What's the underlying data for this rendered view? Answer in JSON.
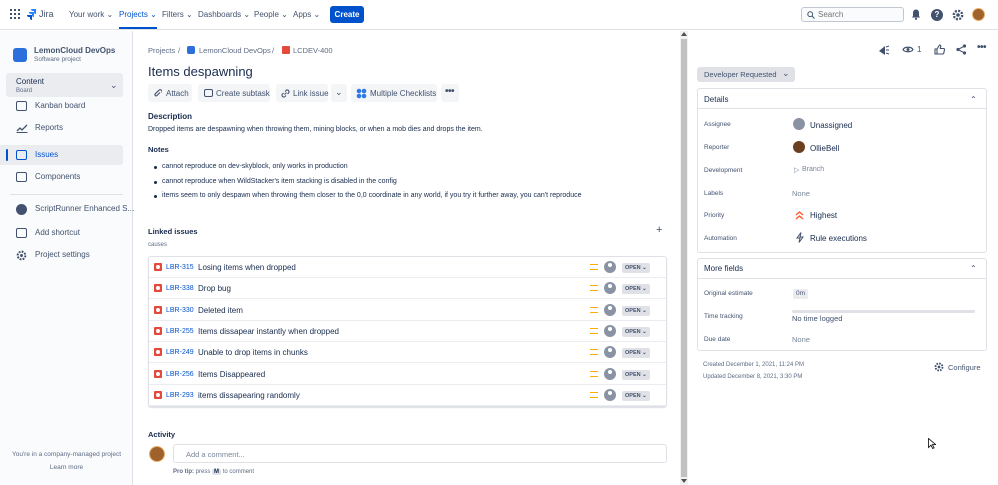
{
  "topnav": {
    "logo": "Jira",
    "items": [
      "Your work",
      "Projects",
      "Filters",
      "Dashboards",
      "People",
      "Apps"
    ],
    "create": "Create",
    "search_placeholder": "Search"
  },
  "sidebar": {
    "project_name": "LemonCloud DevOps",
    "project_type": "Software project",
    "section": "Content",
    "section_sub": "Board",
    "items": [
      "Kanban board",
      "Reports",
      "Issues",
      "Components",
      "ScriptRunner Enhanced S...",
      "Add shortcut",
      "Project settings"
    ],
    "footer": "You're in a company-managed project",
    "learn_more": "Learn more"
  },
  "breadcrumb": [
    "Projects",
    "LemonCloud DevOps",
    "LCDEV-400"
  ],
  "issue": {
    "title": "Items despawning",
    "actions": [
      "Attach",
      "Create subtask",
      "Link issue",
      "Multiple Checklists"
    ],
    "description_label": "Description",
    "description": "Dropped items are despawning when throwing them, mining blocks, or when a mob dies and drops the item.",
    "notes_label": "Notes",
    "notes": [
      "cannot reproduce on dev-skyblock, only works in production",
      "cannot reproduce when WildStacker's item stacking is disabled in the config",
      "items seem to only despawn when throwing them closer to the 0,0 coordinate in any world, if you try it further away, you can't reproduce"
    ],
    "linked_label": "Linked issues",
    "linked_type": "causes",
    "linked": [
      {
        "key": "LBR-315",
        "summary": "Losing items when dropped",
        "status": "OPEN"
      },
      {
        "key": "LBR-338",
        "summary": "Drop bug",
        "status": "OPEN"
      },
      {
        "key": "LBR-330",
        "summary": "Deleted item",
        "status": "OPEN"
      },
      {
        "key": "LBR-255",
        "summary": "Items dissapear instantly when dropped",
        "status": "OPEN"
      },
      {
        "key": "LBR-249",
        "summary": "Unable to drop items in chunks",
        "status": "OPEN"
      },
      {
        "key": "LBR-256",
        "summary": "Items Disappeared",
        "status": "OPEN"
      },
      {
        "key": "LBR-293",
        "summary": "items dissapearing randomly",
        "status": "OPEN"
      }
    ],
    "activity_label": "Activity",
    "comment_placeholder": "Add a comment...",
    "pro_tip_label": "Pro tip:",
    "pro_tip_press": "press",
    "pro_tip_key": "M",
    "pro_tip_rest": "to comment"
  },
  "right": {
    "watch_count": "1",
    "status": "Developer Requested",
    "details_label": "Details",
    "fields": {
      "assignee_label": "Assignee",
      "assignee": "Unassigned",
      "reporter_label": "Reporter",
      "reporter": "OllieBell",
      "development_label": "Development",
      "development": "Branch",
      "labels_label": "Labels",
      "labels": "None",
      "priority_label": "Priority",
      "priority": "Highest",
      "automation_label": "Automation",
      "automation": "Rule executions"
    },
    "more_fields_label": "More fields",
    "more": {
      "estimate_label": "Original estimate",
      "estimate": "0m",
      "tracking_label": "Time tracking",
      "tracking": "No time logged",
      "due_label": "Due date",
      "due": "None"
    },
    "created": "Created December 1, 2021, 11:24 PM",
    "updated": "Updated December 8, 2021, 3:30 PM",
    "configure": "Configure"
  },
  "colors": {
    "accent": "#0052cc",
    "bug": "#e5493a",
    "priority_medium": "#ffab00",
    "priority_highest": "#ff5630"
  }
}
